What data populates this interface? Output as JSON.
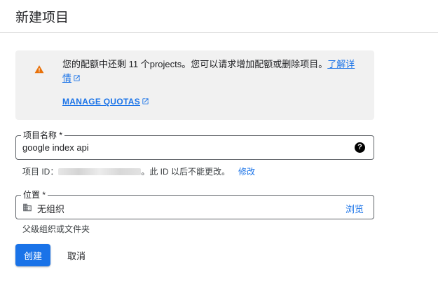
{
  "header": {
    "title": "新建项目"
  },
  "quota": {
    "message": "您的配额中还剩 11 个projects。您可以请求增加配额或删除项目。",
    "learn_more": "了解详情",
    "manage_label": "MANAGE QUOTAS"
  },
  "project_name": {
    "label": "项目名称 *",
    "value": "google index api",
    "help_icon": "?"
  },
  "project_id": {
    "prefix": "项目 ID：",
    "suffix": "。此 ID 以后不能更改。",
    "edit_label": "修改"
  },
  "location": {
    "label": "位置 *",
    "value": "无组织",
    "browse_label": "浏览",
    "hint": "父级组织或文件夹"
  },
  "actions": {
    "create_label": "创建",
    "cancel_label": "取消"
  },
  "colors": {
    "accent": "#1a73e8",
    "warning": "#e8710a",
    "panel": "#f1f1f1"
  },
  "icons": [
    "warning-icon",
    "external-link-icon",
    "help-icon",
    "building-icon"
  ]
}
